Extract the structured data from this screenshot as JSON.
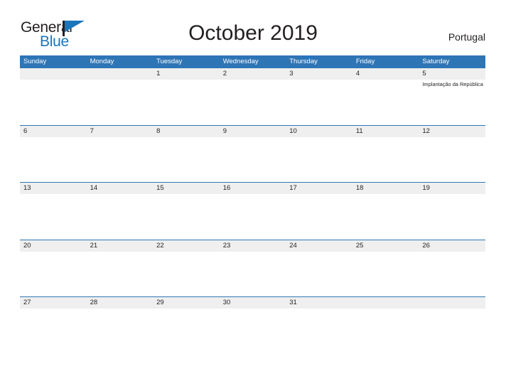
{
  "brand": {
    "name_part1": "General",
    "name_part2": "Blue",
    "flag_icon": "flag-triangle-icon",
    "color_dark": "#231f20",
    "color_blue": "#1b75bb"
  },
  "header": {
    "title": "October 2019",
    "locale": "Portugal"
  },
  "calendar": {
    "accent_color": "#2e75b6",
    "date_strip_color": "#efefef",
    "day_names": [
      "Sunday",
      "Monday",
      "Tuesday",
      "Wednesday",
      "Thursday",
      "Friday",
      "Saturday"
    ],
    "weeks": [
      [
        {
          "date": "",
          "event": ""
        },
        {
          "date": "",
          "event": ""
        },
        {
          "date": "1",
          "event": ""
        },
        {
          "date": "2",
          "event": ""
        },
        {
          "date": "3",
          "event": ""
        },
        {
          "date": "4",
          "event": ""
        },
        {
          "date": "5",
          "event": "Implantação da República"
        }
      ],
      [
        {
          "date": "6",
          "event": ""
        },
        {
          "date": "7",
          "event": ""
        },
        {
          "date": "8",
          "event": ""
        },
        {
          "date": "9",
          "event": ""
        },
        {
          "date": "10",
          "event": ""
        },
        {
          "date": "11",
          "event": ""
        },
        {
          "date": "12",
          "event": ""
        }
      ],
      [
        {
          "date": "13",
          "event": ""
        },
        {
          "date": "14",
          "event": ""
        },
        {
          "date": "15",
          "event": ""
        },
        {
          "date": "16",
          "event": ""
        },
        {
          "date": "17",
          "event": ""
        },
        {
          "date": "18",
          "event": ""
        },
        {
          "date": "19",
          "event": ""
        }
      ],
      [
        {
          "date": "20",
          "event": ""
        },
        {
          "date": "21",
          "event": ""
        },
        {
          "date": "22",
          "event": ""
        },
        {
          "date": "23",
          "event": ""
        },
        {
          "date": "24",
          "event": ""
        },
        {
          "date": "25",
          "event": ""
        },
        {
          "date": "26",
          "event": ""
        }
      ],
      [
        {
          "date": "27",
          "event": ""
        },
        {
          "date": "28",
          "event": ""
        },
        {
          "date": "29",
          "event": ""
        },
        {
          "date": "30",
          "event": ""
        },
        {
          "date": "31",
          "event": ""
        },
        {
          "date": "",
          "event": ""
        },
        {
          "date": "",
          "event": ""
        }
      ]
    ]
  }
}
